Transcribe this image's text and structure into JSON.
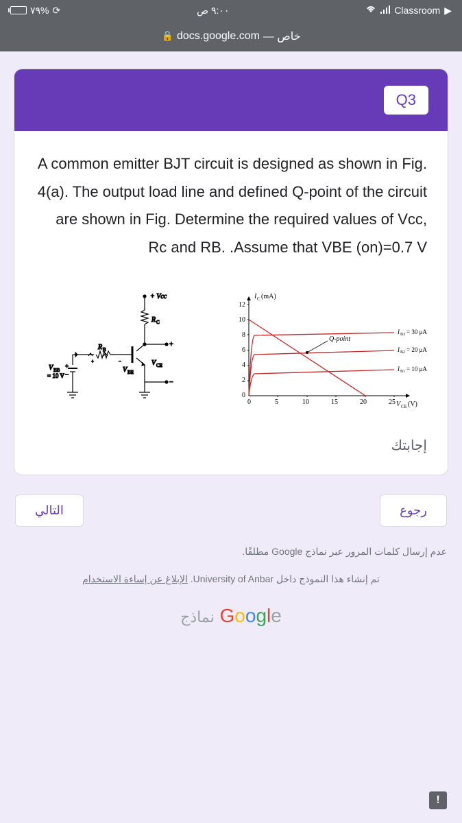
{
  "status_bar": {
    "battery": "٧٩%",
    "time": "٩:٠٠ ص",
    "app": "Classroom"
  },
  "url_bar": {
    "domain": "docs.google.com",
    "suffix": "— خاص"
  },
  "card": {
    "label": "Q3",
    "question": "A common emitter BJT circuit is designed as shown in Fig. 4(a). The output load line and defined Q-point of the circuit are shown in Fig. Determine the required values of Vcc, Rc and RB. .Assume that VBE (on)=0.7 V",
    "answer_label": "إجابتك"
  },
  "circuit": {
    "vcc": "+ Vcc",
    "rc": "R_C",
    "rb": "R_B",
    "vce": "V_CE",
    "vbe": "V_BE",
    "vbb": "V_BB",
    "vbb_val": "= 10 V"
  },
  "chart_data": {
    "type": "line",
    "title": "",
    "xlabel": "V_CE(V)",
    "ylabel": "I_C(mA)",
    "xlim": [
      0,
      25
    ],
    "ylim": [
      0,
      12
    ],
    "xticks": [
      0,
      5,
      10,
      15,
      20,
      25
    ],
    "yticks": [
      0,
      2,
      4,
      6,
      8,
      10,
      12
    ],
    "series": [
      {
        "name": "I_B3 = 30 μA",
        "x": [
          0,
          0.5,
          1,
          25
        ],
        "y": [
          0,
          7.5,
          8,
          8.3
        ]
      },
      {
        "name": "I_B2 = 20 μA",
        "x": [
          0,
          0.5,
          1,
          25
        ],
        "y": [
          0,
          5,
          5.5,
          6
        ]
      },
      {
        "name": "I_B1 = 10 μA",
        "x": [
          0,
          0.5,
          1,
          25
        ],
        "y": [
          0,
          2.5,
          2.8,
          3.2
        ]
      },
      {
        "name": "Load line",
        "x": [
          0,
          20
        ],
        "y": [
          10,
          0
        ]
      }
    ],
    "q_point": {
      "x": 10,
      "y": 5.5,
      "label": "Q-point"
    }
  },
  "buttons": {
    "back": "رجوع",
    "next": "التالي"
  },
  "footer": {
    "line1": "عدم إرسال كلمات المرور عبر نماذج Google مطلقًا.",
    "line2_a": "تم إنشاء هذا النموذج داخل University of Anbar.",
    "line2_link": "الإبلاغ عن إساءة الاستخدام",
    "forms": "نماذج"
  }
}
